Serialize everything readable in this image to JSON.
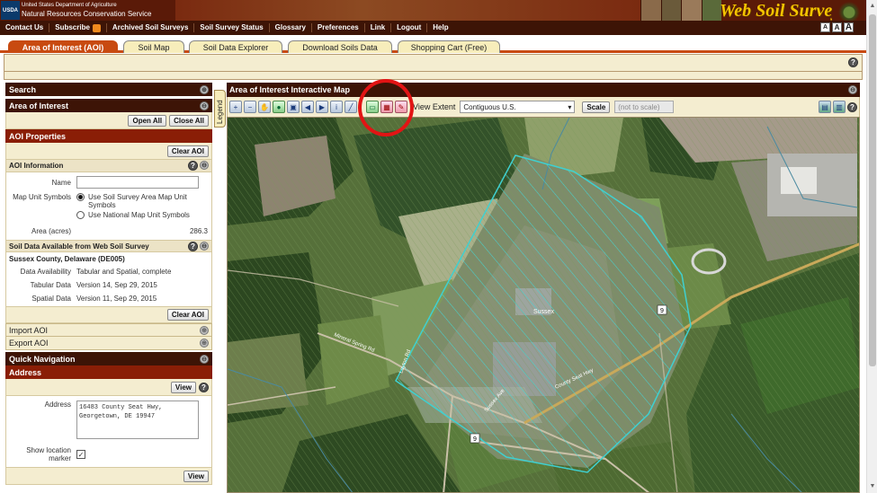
{
  "header": {
    "usda_logo_text": "USDA",
    "agency_line1": "United States Department of Agriculture",
    "agency_line2": "Natural Resources Conservation Service",
    "site_title": "Web Soil Survey"
  },
  "nav": {
    "items": [
      "Contact Us",
      "Subscribe",
      "Archived Soil Surveys",
      "Soil Survey Status",
      "Glossary",
      "Preferences",
      "Link",
      "Logout",
      "Help"
    ],
    "text_size": [
      "A",
      "A",
      "A"
    ]
  },
  "tabs": [
    {
      "label": "Area of Interest (AOI)",
      "active": true
    },
    {
      "label": "Soil Map",
      "active": false
    },
    {
      "label": "Soil Data Explorer",
      "active": false
    },
    {
      "label": "Download Soils Data",
      "active": false
    },
    {
      "label": "Shopping Cart (Free)",
      "active": false
    }
  ],
  "left": {
    "search_title": "Search",
    "aoi_title": "Area of Interest",
    "open_all": "Open All",
    "close_all": "Close All",
    "aoi_props_title": "AOI Properties",
    "clear_aoi": "Clear AOI",
    "aoi_info_title": "AOI Information",
    "name_label": "Name",
    "name_value": "",
    "map_unit_label": "Map Unit Symbols",
    "map_unit_opt1": "Use Soil Survey Area Map Unit Symbols",
    "map_unit_opt2": "Use National Map Unit Symbols",
    "area_label": "Area (acres)",
    "area_value": "286.3",
    "soil_data_title": "Soil Data Available from Web Soil Survey",
    "county": "Sussex County, Delaware (DE005)",
    "availability_label": "Data Availability",
    "availability_value": "Tabular and Spatial, complete",
    "tabular_label": "Tabular Data",
    "tabular_value": "Version 14, Sep 29, 2015",
    "spatial_label": "Spatial Data",
    "spatial_value": "Version 11, Sep 29, 2015",
    "clear_aoi_2": "Clear AOI",
    "import_aoi": "Import AOI",
    "export_aoi": "Export AOI",
    "quick_nav_title": "Quick Navigation",
    "address_title": "Address",
    "view_btn": "View",
    "address_label": "Address",
    "address_line1": "16483 County Seat Hwy,",
    "address_line2": "Georgetown, DE 19947",
    "show_marker_label": "Show location marker",
    "show_marker_checked": "✓",
    "view_btn_2": "View"
  },
  "legend_tab": "Legend",
  "map": {
    "title": "Area of Interest Interactive Map",
    "view_extent_label": "View Extent",
    "view_extent_value": "Contiguous U.S.",
    "scale_btn": "Scale",
    "scale_value": "(not to scale)",
    "town_label": "Sussex",
    "road_labels": [
      "Mineral Spring Rd",
      "Layton Rd",
      "County Seat Hwy",
      "Sussex Ave"
    ],
    "route_shields": [
      "9",
      "9"
    ],
    "aoi_outline_color": "#3fd0d0",
    "annotation_color": "#e21414"
  },
  "colors": {
    "banner": "#5a1a08",
    "navbar": "#3d1406",
    "tab_active": "#c84a10",
    "tab_inactive": "#f7edbb",
    "title_gold": "#f4c400"
  }
}
